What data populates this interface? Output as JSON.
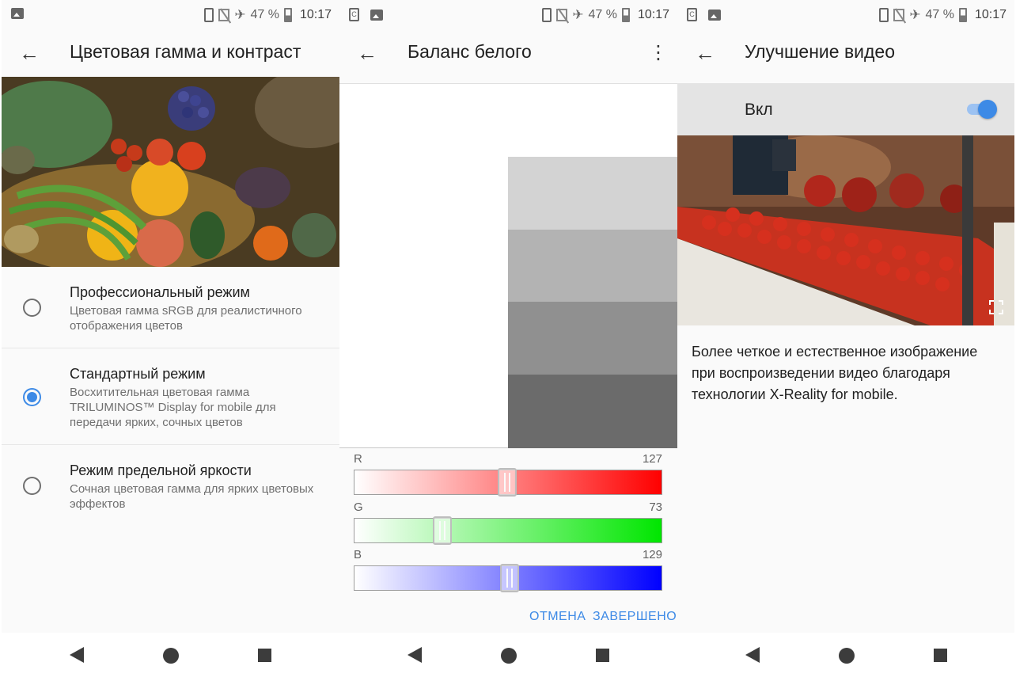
{
  "status_bar": {
    "battery": "47 %",
    "time": "10:17"
  },
  "screen1": {
    "title": "Цветовая гамма и контраст",
    "modes": [
      {
        "title": "Профессиональный режим",
        "description": "Цветовая гамма sRGB для реалистичного отображения цветов",
        "checked": false
      },
      {
        "title": "Стандартный режим",
        "description": "Восхитительная цветовая гамма TRILUMINOS™ Display for mobile для передачи ярких, сочных цветов",
        "checked": true
      },
      {
        "title": "Режим предельной яркости",
        "description": "Сочная цветовая гамма для ярких цветовых эффектов",
        "checked": false
      }
    ]
  },
  "screen2": {
    "title": "Баланс белого",
    "swatches": [
      "#d3d3d3",
      "#b3b3b3",
      "#909090",
      "#6b6b6b"
    ],
    "sliders": [
      {
        "label": "R",
        "value": "127",
        "fraction": 0.498,
        "color": "#ff0000"
      },
      {
        "label": "G",
        "value": "73",
        "fraction": 0.286,
        "color": "#00e600"
      },
      {
        "label": "B",
        "value": "129",
        "fraction": 0.506,
        "color": "#0000ff"
      }
    ],
    "cancel_label": "ОТМЕНА",
    "done_label": "ЗАВЕРШЕНО"
  },
  "screen3": {
    "title": "Улучшение видео",
    "toggle_label": "Вкл",
    "toggle_on": true,
    "description": "Более четкое и естественное изображение при воспроизведении видео благодаря технологии X-Reality for mobile."
  }
}
